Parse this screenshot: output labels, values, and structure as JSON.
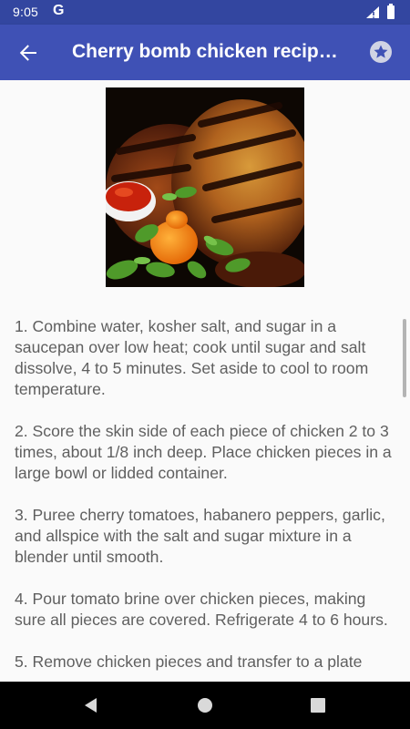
{
  "status_bar": {
    "time": "9:05",
    "notification": "G",
    "signal_icon": "signal-icon",
    "battery_icon": "battery-icon"
  },
  "app_bar": {
    "title": "Cherry bomb chicken recipe…",
    "back_icon": "arrow-back-icon",
    "favorite_icon": "star-icon",
    "background_color": "#3f51b5",
    "status_color": "#3346a0"
  },
  "recipe": {
    "image_icon": "recipe-photo-grilled-chicken",
    "steps": [
      "1. Combine water, kosher salt, and sugar in a saucepan over low heat; cook until sugar and salt dissolve, 4 to 5 minutes. Set aside to cool to room temperature.",
      "2. Score the skin side of each piece of chicken 2 to 3 times, about 1/8 inch deep. Place chicken pieces in a large bowl or lidded container.",
      "3. Puree cherry tomatoes, habanero peppers, garlic, and allspice with the salt and sugar mixture in a blender until smooth.",
      "4. Pour tomato brine over chicken pieces, making sure all pieces are covered. Refrigerate 4 to 6 hours.",
      "5. Remove chicken pieces and transfer to a plate"
    ],
    "text_color": "#5f5f5f"
  },
  "nav_bar": {
    "back_icon": "nav-back-triangle-icon",
    "home_icon": "nav-home-circle-icon",
    "recents_icon": "nav-recents-square-icon"
  }
}
